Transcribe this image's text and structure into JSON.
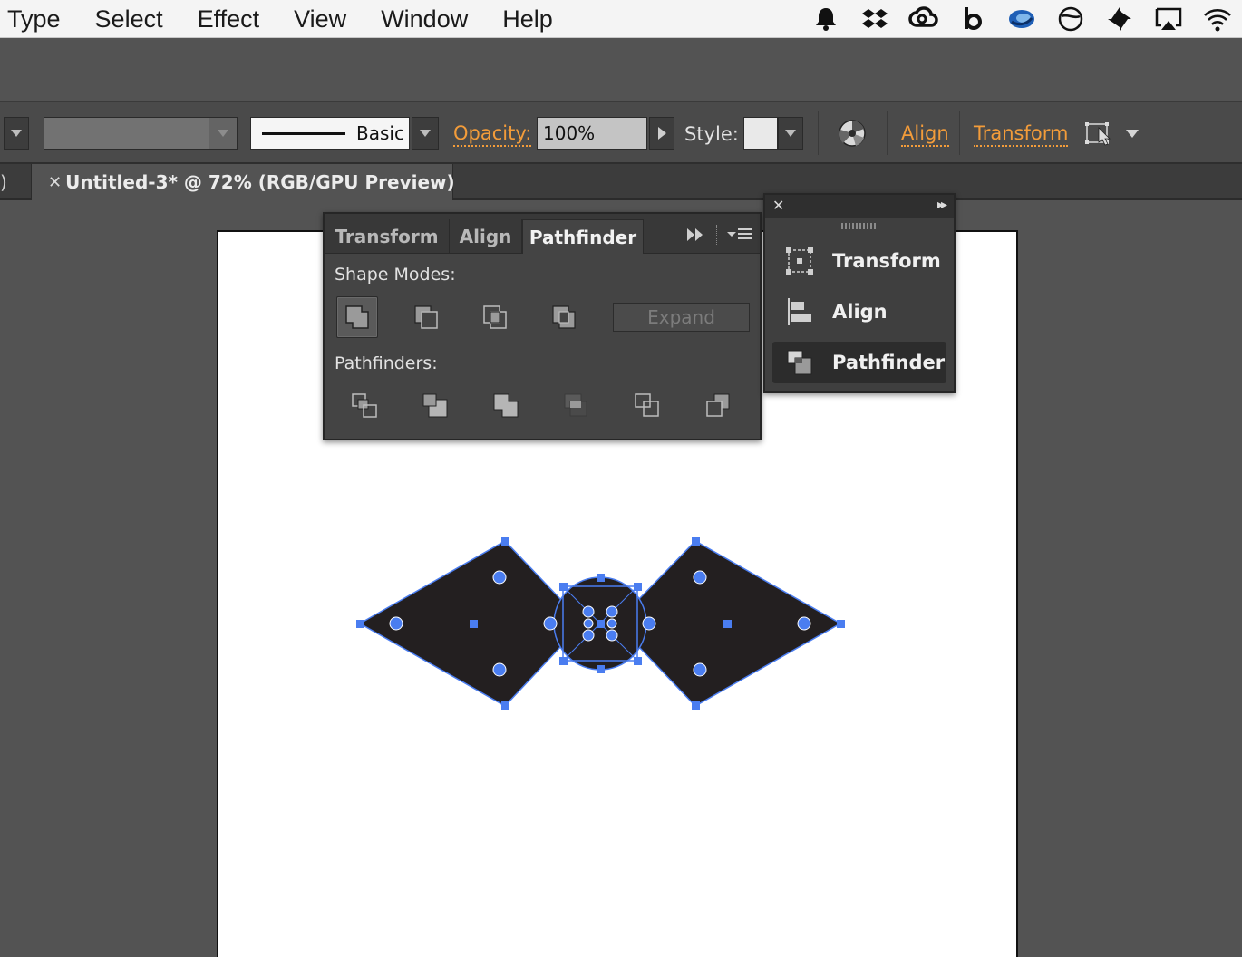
{
  "menubar": {
    "items": [
      "Type",
      "Select",
      "Effect",
      "View",
      "Window",
      "Help"
    ],
    "tray_icons": [
      "bell-icon",
      "dropbox-icon",
      "creative-cloud-icon",
      "b-logo-icon",
      "spinner-app-icon",
      "circle-slash-icon",
      "pinwheel-icon",
      "airplay-icon",
      "wifi-icon"
    ]
  },
  "controlbar": {
    "stroke_profile_label": "Basic",
    "opacity_label": "Opacity:",
    "opacity_value": "100%",
    "style_label": "Style:",
    "align_link": "Align",
    "transform_link": "Transform",
    "accent_color": "#f39c3a"
  },
  "tabbar": {
    "left_fragment": ")",
    "close_glyph": "✕",
    "document_title": "Untitled-3* @ 72% (RGB/GPU Preview)"
  },
  "pathfinder_panel": {
    "tabs": [
      {
        "label": "Transform",
        "active": false
      },
      {
        "label": "Align",
        "active": false
      },
      {
        "label": "Pathfinder",
        "active": true
      }
    ],
    "shape_modes_label": "Shape Modes:",
    "pathfinders_label": "Pathfinders:",
    "expand_label": "Expand",
    "shape_mode_buttons": [
      "unite-icon",
      "minus-front-icon",
      "intersect-icon",
      "exclude-icon"
    ],
    "pathfinder_buttons": [
      "divide-icon",
      "trim-icon",
      "merge-icon",
      "crop-icon",
      "outline-icon",
      "minus-back-icon"
    ]
  },
  "dock": {
    "close_glyph": "✕",
    "expand_glyph": "▸▸",
    "items": [
      {
        "label": "Transform",
        "icon": "transform-icon",
        "selected": false
      },
      {
        "label": "Align",
        "icon": "align-icon",
        "selected": false
      },
      {
        "label": "Pathfinder",
        "icon": "pathfinder-icon",
        "selected": true
      }
    ]
  },
  "artwork": {
    "fill_color": "#231f20",
    "selection_color": "#4a7df0"
  }
}
